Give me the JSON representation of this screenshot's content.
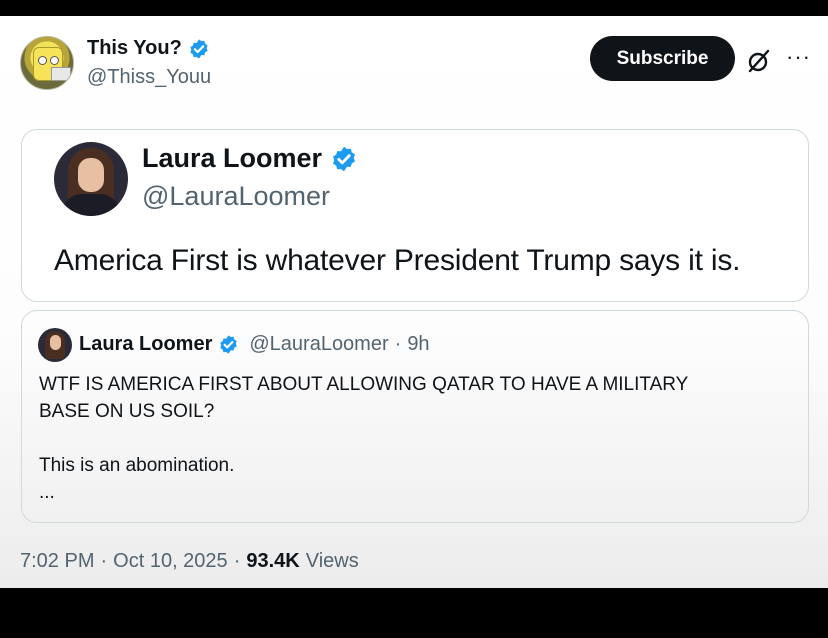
{
  "header": {
    "display_name": "This You?",
    "handle": "@Thiss_Youu",
    "subscribe_label": "Subscribe",
    "more_label": "···",
    "verified_color": "#1d9bf0"
  },
  "quote_card": {
    "display_name": "Laura Loomer",
    "handle": "@LauraLoomer",
    "text": "America First is whatever President Trump says it is."
  },
  "quoted_tweet": {
    "display_name": "Laura Loomer",
    "handle": "@LauraLoomer",
    "separator": "·",
    "time": "9h",
    "lines": [
      "WTF IS AMERICA FIRST ABOUT ALLOWING QATAR TO HAVE A MILITARY",
      "BASE ON US SOIL?",
      "This is an abomination.",
      "..."
    ]
  },
  "footer": {
    "time": "7:02 PM",
    "sep1": "·",
    "date": "Oct 10, 2025",
    "sep2": "·",
    "views_count": "93.4K",
    "views_label": "Views"
  },
  "icons": {
    "verified": "verified-badge-icon",
    "grok": "grok-icon",
    "more": "more-icon"
  }
}
